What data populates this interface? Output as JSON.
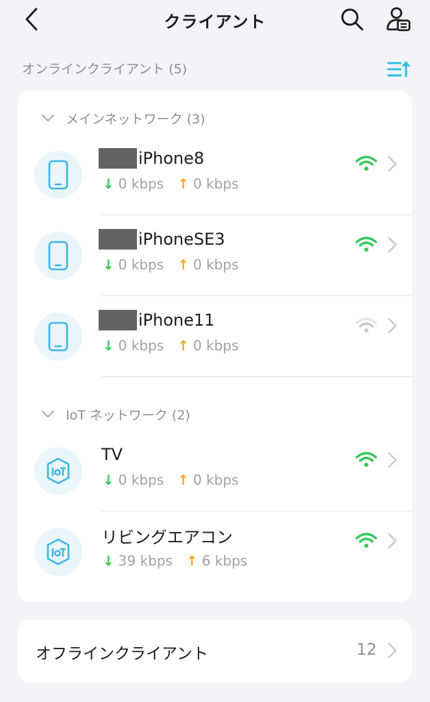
{
  "header": {
    "title": "クライアント",
    "icons": {
      "back": "chevron-left-icon",
      "search": "search-icon",
      "account": "user-card-icon"
    }
  },
  "online": {
    "section_title": "オンラインクライアント (5)",
    "sort_icon": "sort-icon",
    "groups": [
      {
        "title": "メインネットワーク (3)",
        "icon": "chevron-down-icon",
        "clients": [
          {
            "name": "iPhone8",
            "redacted_prefix": true,
            "device_icon": "smartphone-icon",
            "download": "0 kbps",
            "upload": "0 kbps",
            "signal": "strong",
            "signal_color": "#34c759"
          },
          {
            "name": "iPhoneSE3",
            "redacted_prefix": true,
            "device_icon": "smartphone-icon",
            "download": "0 kbps",
            "upload": "0 kbps",
            "signal": "strong",
            "signal_color": "#34c759"
          },
          {
            "name": "iPhone11",
            "redacted_prefix": true,
            "device_icon": "smartphone-icon",
            "download": "0 kbps",
            "upload": "0 kbps",
            "signal": "weak",
            "signal_color": "#c7c7cc"
          }
        ]
      },
      {
        "title": "IoT ネットワーク (2)",
        "icon": "chevron-down-icon",
        "clients": [
          {
            "name": "TV",
            "redacted_prefix": false,
            "device_icon": "iot-icon",
            "download": "0 kbps",
            "upload": "0 kbps",
            "signal": "strong",
            "signal_color": "#34c759"
          },
          {
            "name": "リビングエアコン",
            "redacted_prefix": false,
            "device_icon": "iot-icon",
            "download": "39 kbps",
            "upload": "6 kbps",
            "signal": "strong",
            "signal_color": "#34c759"
          }
        ]
      }
    ]
  },
  "offline": {
    "label": "オフラインクライアント",
    "count": "12"
  },
  "colors": {
    "accent": "#2cc1e0",
    "download_arrow": "#34c759",
    "upload_arrow": "#f5a623",
    "avatar_bg": "#e9f6fc"
  }
}
